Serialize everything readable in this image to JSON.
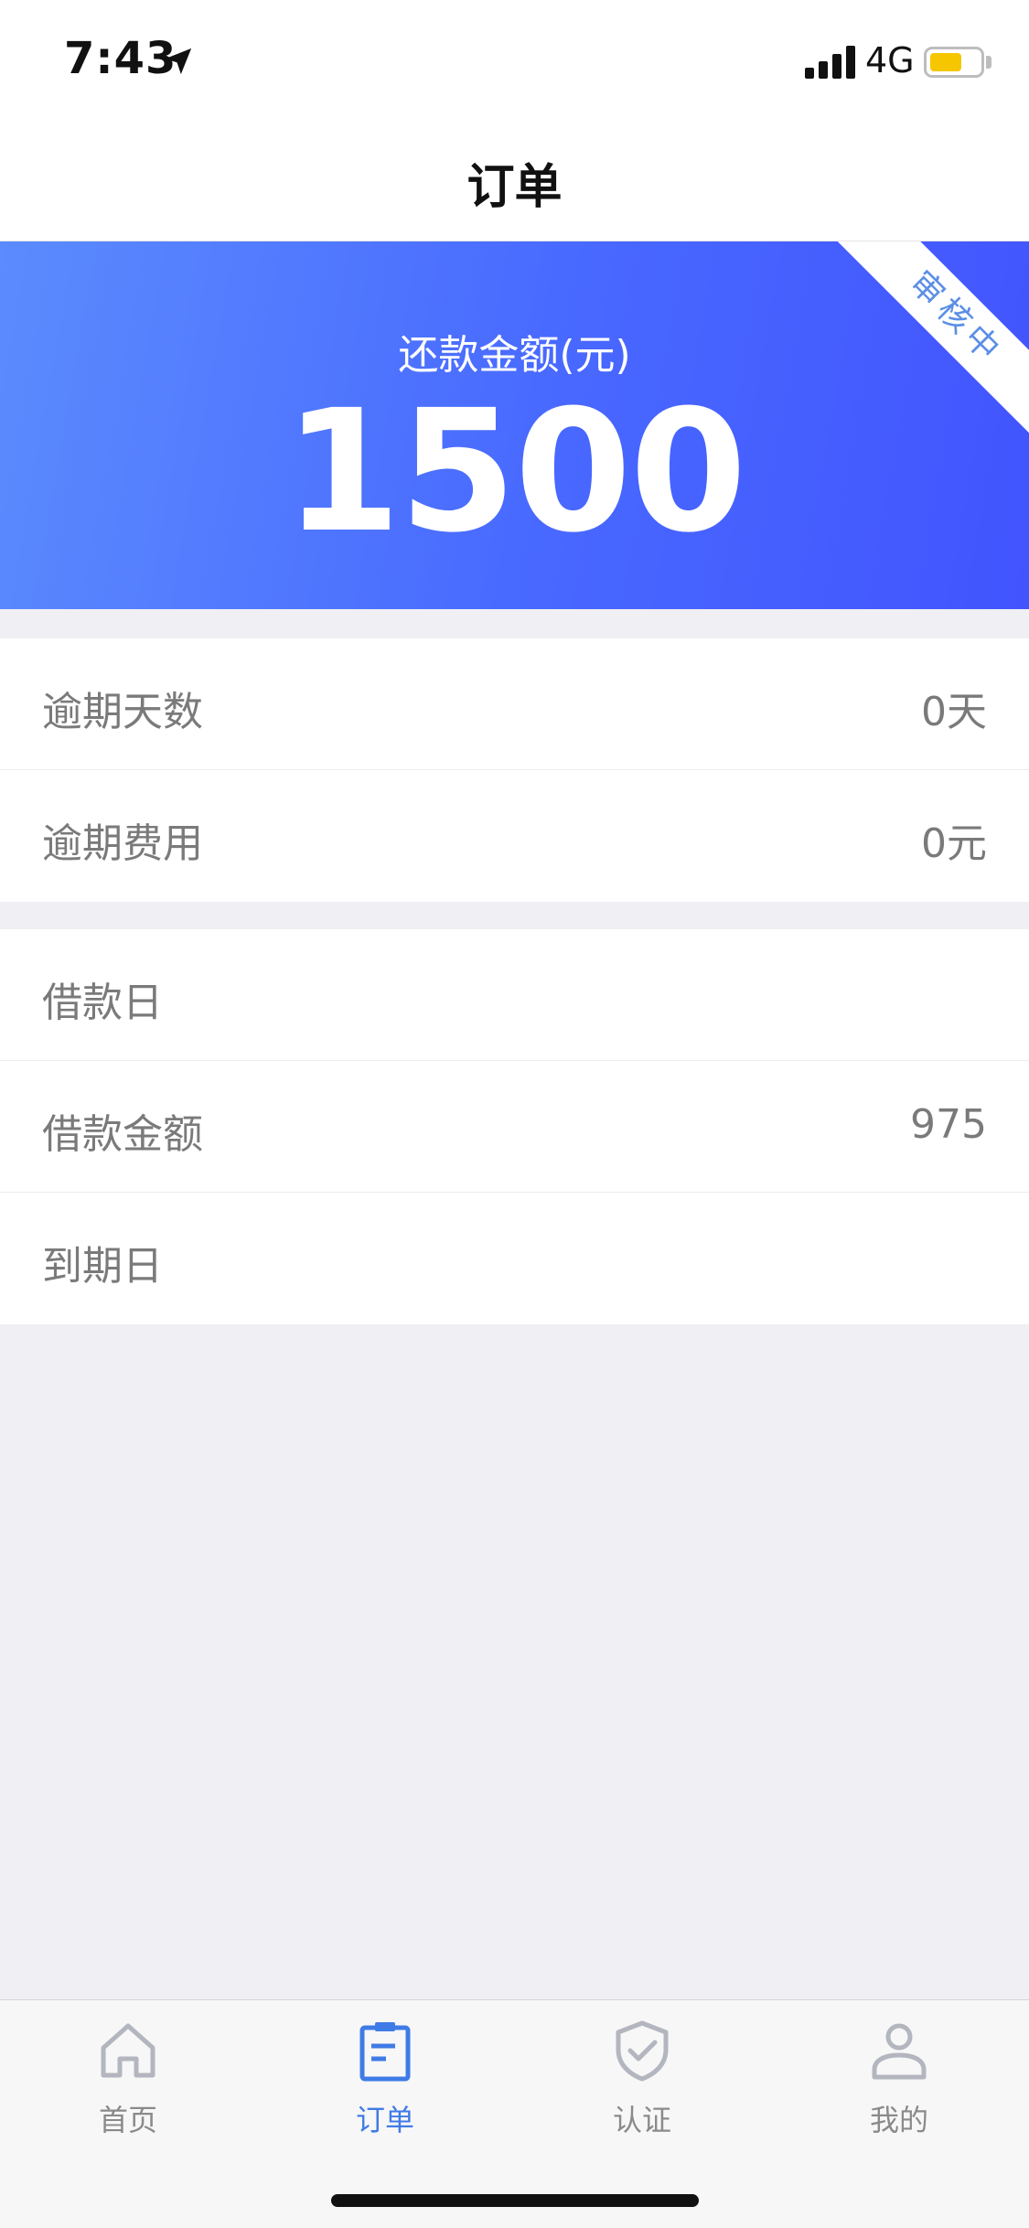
{
  "status_bar": {
    "time": "7:43",
    "network": "4G",
    "icons": [
      "location-arrow-icon",
      "signal-icon",
      "battery-icon"
    ],
    "battery_color": "#f6c600"
  },
  "nav": {
    "title": "订单"
  },
  "hero": {
    "label": "还款金额(元)",
    "amount": "1500",
    "ribbon": "审核中",
    "gradient_start": "#5b8bfd",
    "gradient_end": "#4254fe"
  },
  "overdue": {
    "rows": [
      {
        "label": "逾期天数",
        "value": "0天"
      },
      {
        "label": "逾期费用",
        "value": "0元"
      }
    ]
  },
  "loan": {
    "rows": [
      {
        "label": "借款日",
        "value": ""
      },
      {
        "label": "借款金额",
        "value": "975"
      },
      {
        "label": "到期日",
        "value": ""
      }
    ]
  },
  "tabs": [
    {
      "label": "首页",
      "icon": "home-icon",
      "active": false
    },
    {
      "label": "订单",
      "icon": "order-clipboard-icon",
      "active": true
    },
    {
      "label": "认证",
      "icon": "shield-check-icon",
      "active": false
    },
    {
      "label": "我的",
      "icon": "user-icon",
      "active": false
    }
  ],
  "colors": {
    "accent": "#3f7be6",
    "inactive": "#8a8a8a",
    "background": "#efeff4"
  }
}
